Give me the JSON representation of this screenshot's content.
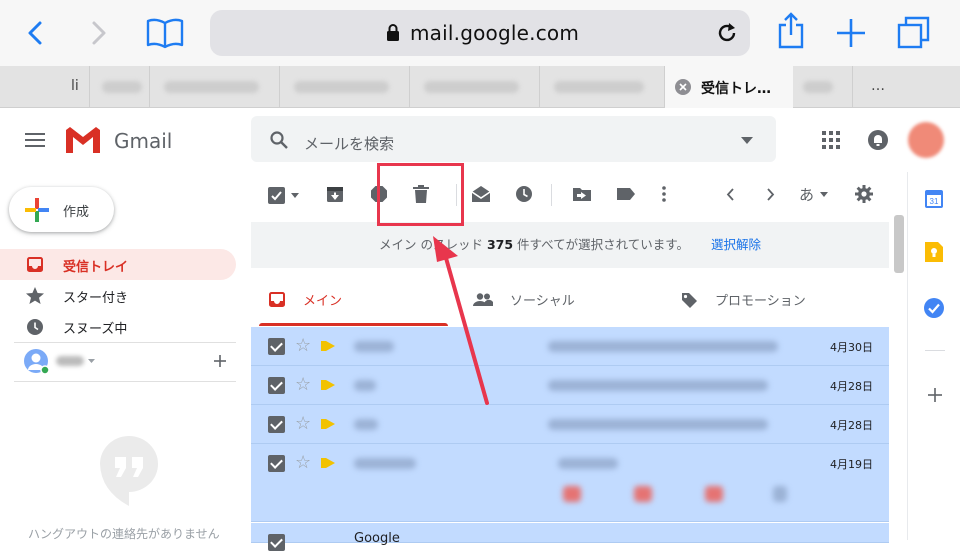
{
  "browser": {
    "url": "mail.google.com",
    "tabs": [
      {
        "label": "li"
      },
      {
        "label": ""
      },
      {
        "label": ""
      },
      {
        "label": ""
      },
      {
        "label": ""
      },
      {
        "label": ""
      },
      {
        "label": "受信トレ…",
        "active": true
      },
      {
        "label": ""
      },
      {
        "label": "…"
      }
    ]
  },
  "gmail": {
    "product_name": "Gmail",
    "search_placeholder": "メールを検索",
    "compose_label": "作成",
    "nav": [
      {
        "label": "受信トレイ",
        "icon": "inbox-icon",
        "active": true
      },
      {
        "label": "スター付き",
        "icon": "star-icon"
      },
      {
        "label": "スヌーズ中",
        "icon": "clock-icon"
      }
    ],
    "hangouts_empty": "ハングアウトの連絡先がありません",
    "toolbar": {
      "input_tools_label": "あ"
    },
    "banner": {
      "prefix": "メイン のスレッド ",
      "count": "375",
      "suffix": " 件すべてが選択されています。",
      "action": "選択解除"
    },
    "categories": [
      {
        "label": "メイン",
        "icon": "inbox-icon",
        "active": true
      },
      {
        "label": "ソーシャル",
        "icon": "people-icon"
      },
      {
        "label": "プロモーション",
        "icon": "tag-icon"
      }
    ],
    "emails": [
      {
        "date": "4月30日",
        "selected": true
      },
      {
        "date": "4月28日",
        "selected": true
      },
      {
        "date": "4月28日",
        "selected": true
      },
      {
        "date": "4月19日",
        "selected": true
      }
    ],
    "partial_row_sender": "Google"
  },
  "colors": {
    "accent_red": "#e8364d",
    "selected_row": "#c2dbff",
    "link_blue": "#1a73e8",
    "safari_blue": "#1e7cf2"
  }
}
